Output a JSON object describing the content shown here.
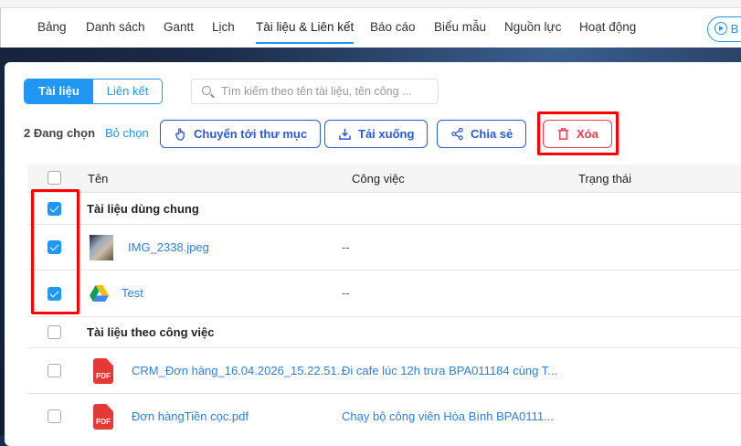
{
  "nav": {
    "tabs": [
      "Bảng",
      "Danh sách",
      "Gantt",
      "Lịch",
      "Tài liệu & Liên kết",
      "Báo cáo",
      "Biểu mẫu",
      "Nguồn lực",
      "Hoạt động"
    ],
    "active": "Tài liệu & Liên kết",
    "right_button": "B"
  },
  "segment": {
    "documents": "Tài liệu",
    "links": "Liên kết"
  },
  "search": {
    "placeholder": "Tìm kiếm theo tên tài liệu, tên công ..."
  },
  "toolbar": {
    "selected_count": "2 Đang chọn",
    "deselect": "Bỏ chọn",
    "move": "Chuyển tới thư mục",
    "download": "Tải xuống",
    "share": "Chia sẻ",
    "delete": "Xóa"
  },
  "table": {
    "headers": [
      "Tên",
      "Công việc",
      "Trạng thái"
    ],
    "groups": [
      {
        "name": "Tài liệu dùng chung",
        "checked": true,
        "items": [
          {
            "name": "IMG_2338.jpeg",
            "task": "--",
            "icon": "image-thumbnail",
            "checked": true
          },
          {
            "name": "Test",
            "task": "--",
            "icon": "google-drive-icon",
            "checked": true
          }
        ]
      },
      {
        "name": "Tài liệu theo công việc",
        "checked": false,
        "items": [
          {
            "name": "CRM_Đơn hàng_16.04.2026_15.22.51...",
            "task": "Đi cafe lúc 12h trưa BPA011184 cùng T...",
            "icon": "pdf-icon",
            "checked": false
          },
          {
            "name": "Đơn hàngTiền cọc.pdf",
            "task": "Chạy bộ công viên Hòa Bình BPA0111...",
            "icon": "pdf-icon",
            "checked": false
          }
        ]
      }
    ],
    "pdf_label": "PDF"
  },
  "colors": {
    "accent": "#2196f3",
    "danger": "#e53e4f",
    "highlight": "#ff0000"
  }
}
